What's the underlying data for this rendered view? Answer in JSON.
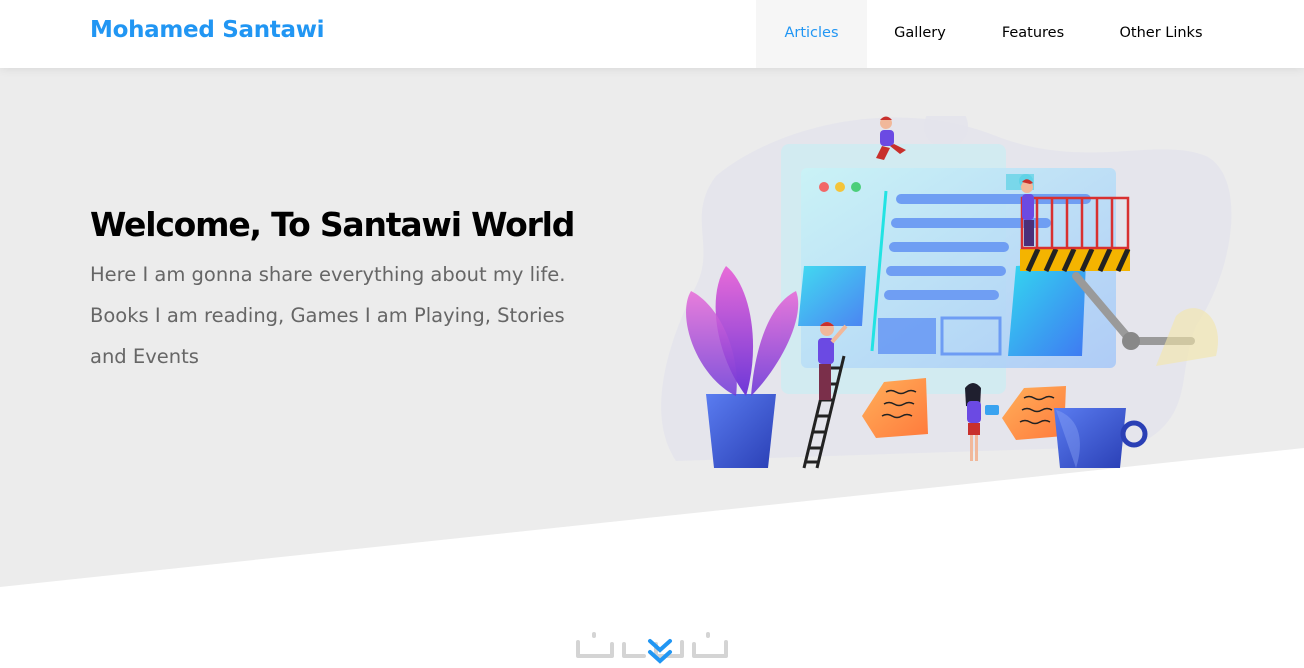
{
  "header": {
    "logo": "Mohamed Santawi",
    "nav": [
      {
        "label": "Articles",
        "active": true
      },
      {
        "label": "Gallery",
        "active": false
      },
      {
        "label": "Features",
        "active": false
      },
      {
        "label": "Other Links",
        "active": false
      }
    ]
  },
  "landing": {
    "title": "Welcome, To Santawi World",
    "description": "Here I am gonna share everything about my life. Books I am reading, Games I am Playing, Stories and Events",
    "illustration": "landing-illustration",
    "go_down_icon": "double-chevron-down-icon"
  },
  "colors": {
    "main": "#2196f3",
    "landing_bg": "#ececec",
    "text_muted": "#666666"
  }
}
